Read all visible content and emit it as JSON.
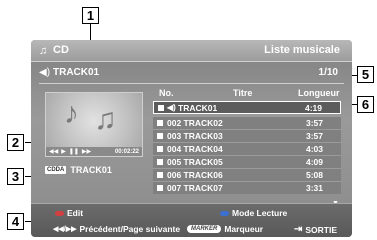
{
  "callouts": [
    "1",
    "2",
    "3",
    "4",
    "5",
    "6"
  ],
  "header": {
    "disc_type": "CD",
    "title": "Liste musicale"
  },
  "now_playing": {
    "track": "TRACK01",
    "page": "1/10"
  },
  "preview": {
    "time": "00:02:22",
    "format_badge": "CDDA",
    "track": "TRACK01"
  },
  "list": {
    "columns": {
      "no": "No.",
      "title": "Titre",
      "length": "Longueur"
    },
    "rows": [
      {
        "name": "TRACK01",
        "duration": "4:19"
      },
      {
        "name": "002  TRACK02",
        "duration": "3:57"
      },
      {
        "name": "003  TRACK03",
        "duration": "3:57"
      },
      {
        "name": "004  TRACK04",
        "duration": "4:03"
      },
      {
        "name": "005  TRACK05",
        "duration": "4:09"
      },
      {
        "name": "006  TRACK06",
        "duration": "5:08"
      },
      {
        "name": "007  TRACK07",
        "duration": "3:31"
      }
    ]
  },
  "help": {
    "edit": "Edit",
    "play_mode": "Mode Lecture",
    "prev_next": "Précédent/Page suivante",
    "marker_icon": "MARKER",
    "marker": "Marqueur",
    "exit": "SORTIE"
  }
}
